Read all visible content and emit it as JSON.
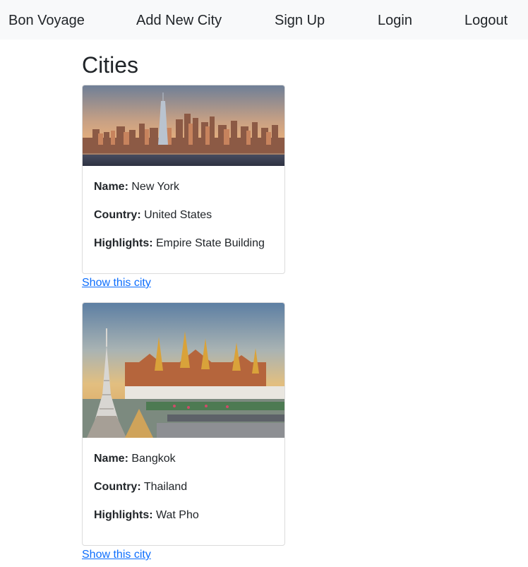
{
  "nav": {
    "brand": "Bon Voyage",
    "links": [
      "Add New City",
      "Sign Up",
      "Login",
      "Logout"
    ]
  },
  "page": {
    "title": "Cities"
  },
  "labels": {
    "name": "Name:",
    "country": "Country:",
    "highlights": "Highlights:"
  },
  "cities": [
    {
      "name": "New York",
      "country": "United States",
      "highlights": "Empire State Building",
      "link": "Show this city"
    },
    {
      "name": "Bangkok",
      "country": "Thailand",
      "highlights": "Wat Pho",
      "link": "Show this city"
    }
  ]
}
